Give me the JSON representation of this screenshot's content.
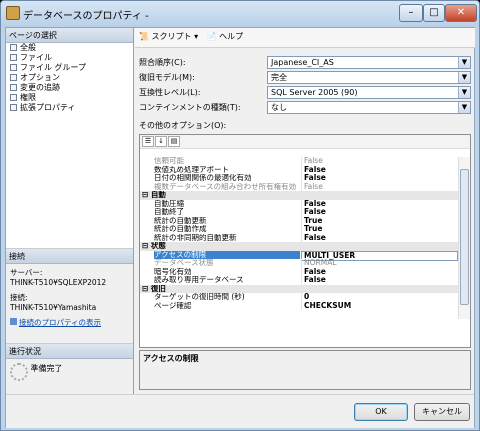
{
  "window": {
    "title": "データベースのプロパティ -"
  },
  "left": {
    "select_header": "ページの選択",
    "pages": [
      "全般",
      "ファイル",
      "ファイル グループ",
      "オプション",
      "変更の追跡",
      "権限",
      "拡張プロパティ"
    ],
    "connection_header": "接続",
    "server_label": "サーバー:",
    "server_value": "THINK-T510¥SQLEXP2012",
    "conn_label": "接続:",
    "conn_value": "THINK-T510¥Yamashita",
    "conn_link": "接続のプロパティの表示",
    "progress_header": "進行状況",
    "progress_text": "準備完了"
  },
  "toolbar": {
    "script": "スクリプト",
    "help": "ヘルプ"
  },
  "form": {
    "collation_label": "照合順序(C):",
    "collation_value": "Japanese_CI_AS",
    "recovery_label": "復旧モデル(M):",
    "recovery_value": "完全",
    "compat_label": "互換性レベル(L):",
    "compat_value": "SQL Server 2005 (90)",
    "contain_label": "コンテインメントの種類(T):",
    "contain_value": "なし",
    "other_label": "その他のオプション(O):"
  },
  "grid": {
    "rows": [
      {
        "n": "信頼可能",
        "v": "False",
        "t": "dis"
      },
      {
        "n": "数値丸め処理アボート",
        "v": "False",
        "t": "bold"
      },
      {
        "n": "日付の相関関係の最適化有効",
        "v": "False",
        "t": "bold"
      },
      {
        "n": "複数データベースの組み合わせ所有権有効",
        "v": "False",
        "t": "dis"
      },
      {
        "n": "自動",
        "v": "",
        "t": "cat"
      },
      {
        "n": "自動圧縮",
        "v": "False",
        "t": "bold"
      },
      {
        "n": "自動終了",
        "v": "False",
        "t": "bold"
      },
      {
        "n": "統計の自動更新",
        "v": "True",
        "t": "bold"
      },
      {
        "n": "統計の自動作成",
        "v": "True",
        "t": "bold"
      },
      {
        "n": "統計の非同期的自動更新",
        "v": "False",
        "t": "bold"
      },
      {
        "n": "状態",
        "v": "",
        "t": "cat"
      },
      {
        "n": "アクセスの制限",
        "v": "MULTI_USER",
        "t": "sel"
      },
      {
        "n": "データベース状態",
        "v": "NORMAL",
        "t": "dis"
      },
      {
        "n": "暗号化有効",
        "v": "False",
        "t": "bold"
      },
      {
        "n": "読み取り専用データベース",
        "v": "False",
        "t": "bold"
      },
      {
        "n": "復旧",
        "v": "",
        "t": "cat"
      },
      {
        "n": "ターゲットの復旧時間 (秒)",
        "v": "0",
        "t": "bold"
      },
      {
        "n": "ページ確認",
        "v": "CHECKSUM",
        "t": "bold"
      }
    ],
    "description": "アクセスの制限"
  },
  "buttons": {
    "ok": "OK",
    "cancel": "キャンセル"
  }
}
